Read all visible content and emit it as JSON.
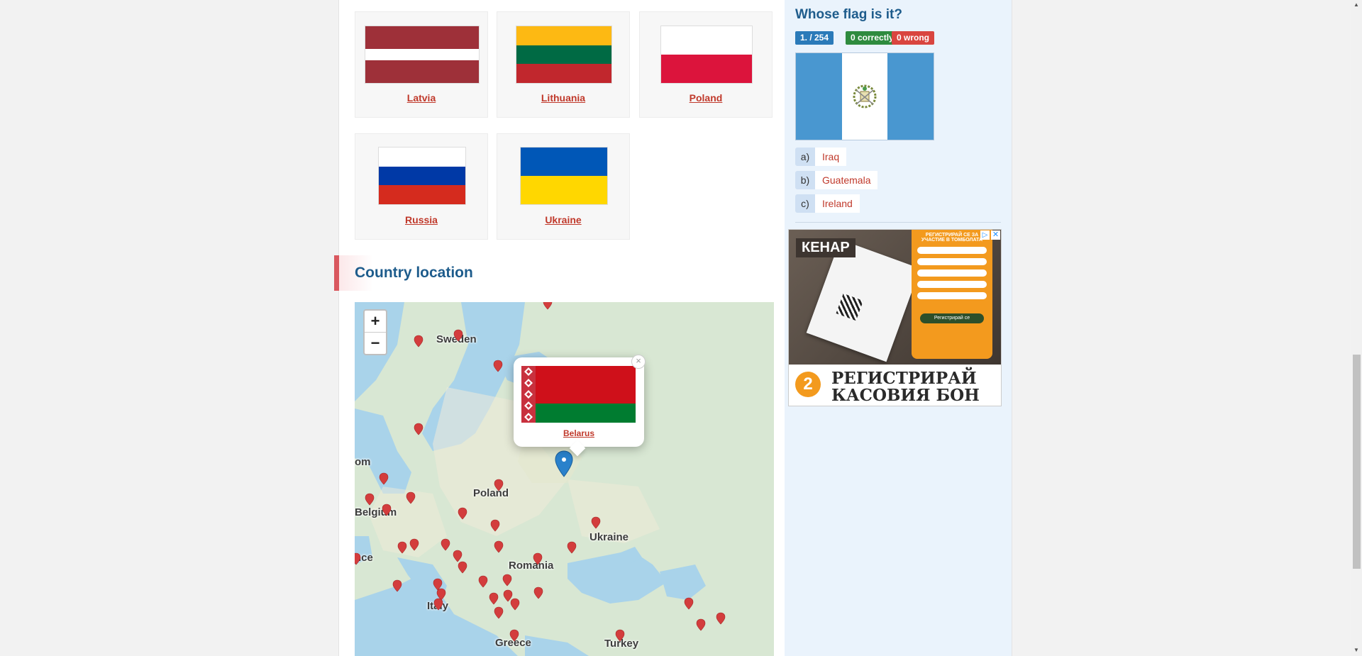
{
  "flags": [
    {
      "name": "Latvia"
    },
    {
      "name": "Lithuania"
    },
    {
      "name": "Poland"
    },
    {
      "name": "Russia"
    },
    {
      "name": "Ukraine"
    }
  ],
  "section": {
    "title": "Country location"
  },
  "map": {
    "zoom_in": "+",
    "zoom_out": "−",
    "labels": {
      "sweden": "Sweden",
      "poland": "Poland",
      "ukraine": "Ukraine",
      "belgium": "Belgium",
      "romania": "Romania",
      "italy": "Italy",
      "greece": "Greece",
      "turkey": "Turkey",
      "france": "nce",
      "uk": "om"
    },
    "popup": {
      "country": "Belarus",
      "close": "×"
    }
  },
  "quiz": {
    "title": "Whose flag is it?",
    "progress": "1. / 254",
    "correct": "0  correctly",
    "wrong": "0  wrong",
    "answers": [
      {
        "letter": "a)",
        "text": "Iraq"
      },
      {
        "letter": "b)",
        "text": "Guatemala"
      },
      {
        "letter": "c)",
        "text": "Ireland"
      }
    ]
  },
  "ad": {
    "brand": "КЕНАР",
    "header": "РЕГИСТРИРАЙ СЕ ЗА УЧАСТИЕ В ТОМБОЛАТА",
    "button": "Регистрирай се",
    "step": "2",
    "caption_line1": "РЕГИСТРИРАЙ",
    "caption_line2": "КАСОВИЯ БОН"
  }
}
